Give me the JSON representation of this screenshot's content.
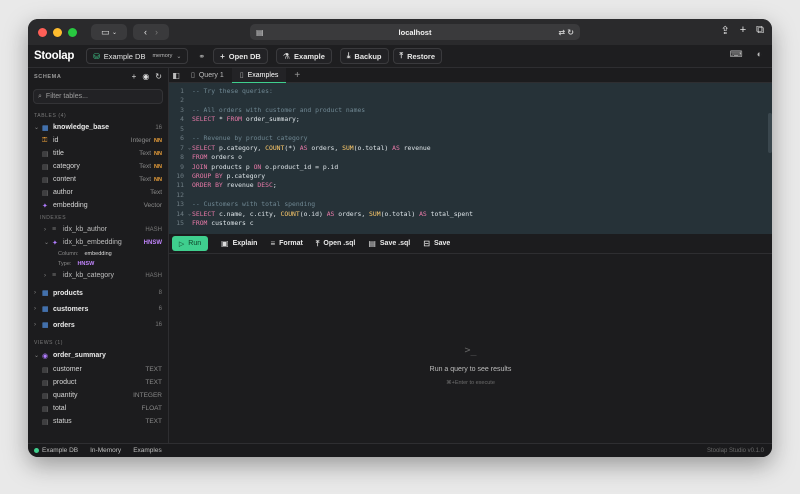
{
  "browser": {
    "url": "localhost"
  },
  "app": {
    "logo": "Stoolap",
    "db_name": "Example DB",
    "db_mode": "memory",
    "toolbar": {
      "open_db": "Open DB",
      "example": "Example",
      "backup": "Backup",
      "restore": "Restore"
    }
  },
  "sidebar": {
    "title": "SCHEMA",
    "filter_placeholder": "Filter tables...",
    "tables_header": "TABLES (4)",
    "kb_table": {
      "name": "knowledge_base",
      "count": "16",
      "columns": [
        {
          "name": "id",
          "type": "Integer",
          "nn": "NN"
        },
        {
          "name": "title",
          "type": "Text",
          "nn": "NN"
        },
        {
          "name": "category",
          "type": "Text",
          "nn": "NN"
        },
        {
          "name": "content",
          "type": "Text",
          "nn": "NN"
        },
        {
          "name": "author",
          "type": "Text",
          "nn": ""
        },
        {
          "name": "embedding",
          "type": "Vector",
          "nn": ""
        }
      ],
      "indexes_header": "INDEXES",
      "indexes": [
        {
          "name": "idx_kb_author",
          "type": "HASH"
        },
        {
          "name": "idx_kb_embedding",
          "type": "HNSW"
        },
        {
          "name": "idx_kb_category",
          "type": "HASH"
        }
      ],
      "embedding_detail": {
        "column_label": "Column:",
        "column_value": "embedding",
        "type_label": "Type:",
        "type_value": "HNSW"
      }
    },
    "other_tables": [
      {
        "name": "products",
        "count": "8"
      },
      {
        "name": "customers",
        "count": "6"
      },
      {
        "name": "orders",
        "count": "16"
      }
    ],
    "views_header": "VIEWS (1)",
    "view": {
      "name": "order_summary",
      "columns": [
        {
          "name": "customer",
          "type": "TEXT"
        },
        {
          "name": "product",
          "type": "TEXT"
        },
        {
          "name": "quantity",
          "type": "INTEGER"
        },
        {
          "name": "total",
          "type": "FLOAT"
        },
        {
          "name": "status",
          "type": "TEXT"
        }
      ]
    }
  },
  "tabs": [
    {
      "label": "Query 1"
    },
    {
      "label": "Examples"
    }
  ],
  "editor": {
    "line_numbers": [
      "1",
      "2",
      "3",
      "4",
      "5",
      "6",
      "7",
      "8",
      "9",
      "10",
      "11",
      "12",
      "13",
      "14",
      "15"
    ]
  },
  "actions": {
    "run": "Run",
    "explain": "Explain",
    "format": "Format",
    "open_sql": "Open .sql",
    "save_sql": "Save .sql",
    "save": "Save"
  },
  "results": {
    "prompt_icon": ">_",
    "message": "Run a query to see results",
    "hint": "⌘+Enter to execute"
  },
  "statusbar": {
    "db": "Example DB",
    "mode": "In-Memory",
    "tab": "Examples",
    "version": "Stoolap Studio v0.1.0"
  },
  "colors": {
    "accent": "#3fcf8e",
    "keyword": "#e879a8",
    "function": "#ffcb6b",
    "comment": "#6f8792",
    "editor_bg": "#263238"
  }
}
